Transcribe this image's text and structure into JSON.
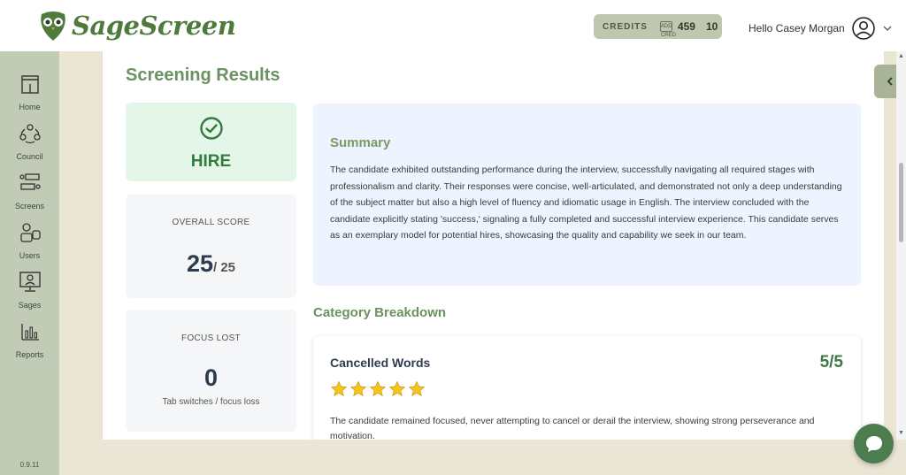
{
  "header": {
    "logo_text": "SageScreen",
    "credits_label": "CREDITS",
    "credit_icon_1": "ADD CRED",
    "credits_value_1": "459",
    "credits_value_2": "10",
    "greeting": "Hello Casey Morgan"
  },
  "sidebar": {
    "items": [
      {
        "label": "Home",
        "icon": "home-icon"
      },
      {
        "label": "Council",
        "icon": "council-icon"
      },
      {
        "label": "Screens",
        "icon": "screens-icon"
      },
      {
        "label": "Users",
        "icon": "users-icon"
      },
      {
        "label": "Sages",
        "icon": "sages-icon"
      },
      {
        "label": "Reports",
        "icon": "reports-icon"
      }
    ],
    "version": "0.9.11"
  },
  "main": {
    "title": "Screening Results",
    "decision": "HIRE",
    "overall_label": "OVERALL SCORE",
    "overall_score": "25",
    "overall_max": "/ 25",
    "focus_label": "FOCUS LOST",
    "focus_value": "0",
    "focus_sub": "Tab switches / focus loss",
    "summary_title": "Summary",
    "summary_text": "The candidate exhibited outstanding performance during the interview, successfully navigating all required stages with professionalism and clarity. Their responses were concise, well-articulated, and demonstrated not only a deep understanding of the subject matter but also a high level of fluency and idiomatic usage in English. The interview concluded with the candidate explicitly stating 'success,' signaling a fully completed and successful interview experience. This candidate serves as an exemplary model for potential hires, showcasing the quality and capability we seek in our team.",
    "breakdown_title": "Category Breakdown",
    "category": {
      "name": "Cancelled Words",
      "score": "5/5",
      "stars": 5,
      "text": "The candidate remained focused, never attempting to cancel or derail the interview, showing strong perseverance and motivation."
    }
  },
  "colors": {
    "accent_green": "#6b9161",
    "sidebar_bg": "#c2cbb5",
    "hire_bg": "#e4f6e8",
    "summary_bg": "#edf4ff",
    "chat_bg": "#4c7d4e",
    "star": "#f5c518"
  }
}
